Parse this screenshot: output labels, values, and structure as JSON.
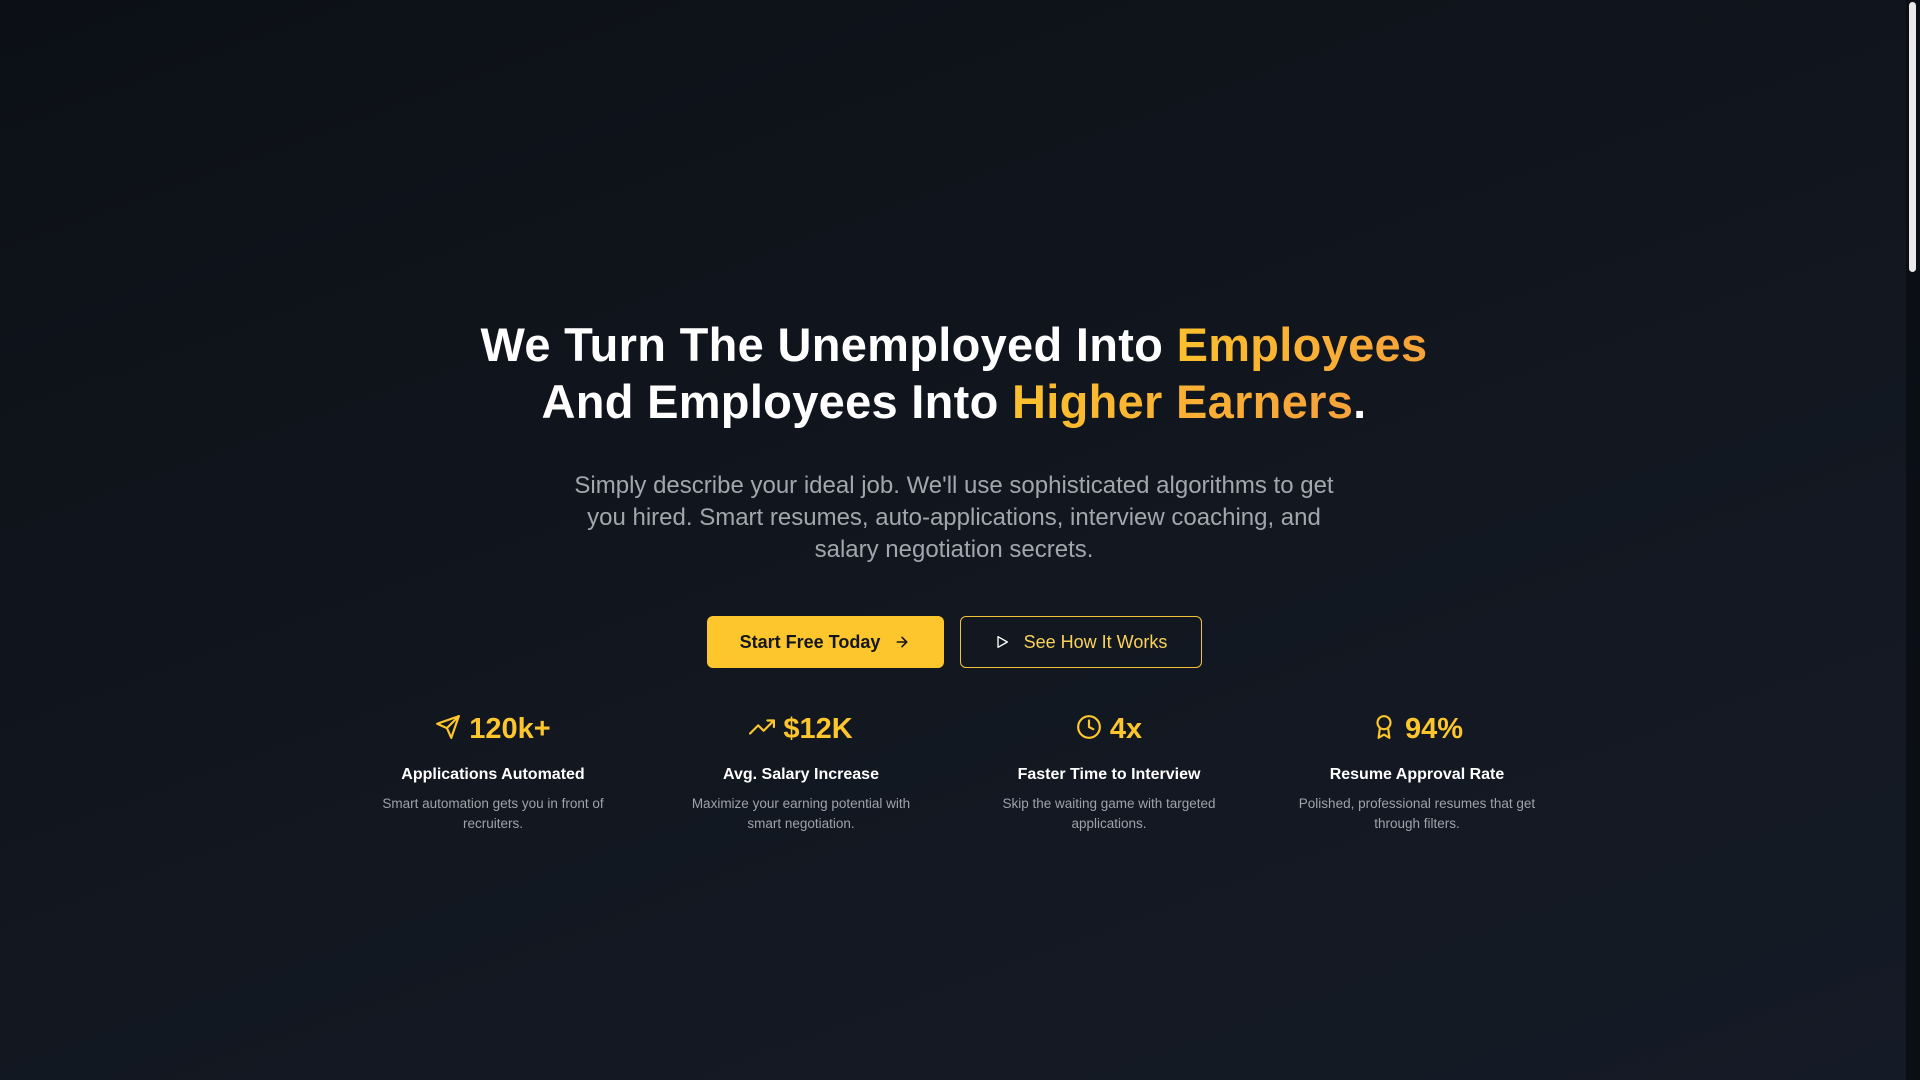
{
  "hero": {
    "headline_line1_prefix": "We Turn The Unemployed Into ",
    "headline_line1_accent": "Employees",
    "headline_line2_prefix": "And Employees Into ",
    "headline_line2_accent": "Higher Earners",
    "headline_line2_suffix": ".",
    "subtitle": "Simply describe your ideal job. We'll use sophisticated algorithms to get you hired. Smart resumes, auto-applications, interview coaching, and salary negotiation secrets.",
    "primary_cta": "Start Free Today",
    "secondary_cta": "See How It Works"
  },
  "stats": [
    {
      "icon": "send-icon",
      "value": "120k+",
      "title": "Applications Automated",
      "description": "Smart automation gets you in front of recruiters."
    },
    {
      "icon": "trending-up-icon",
      "value": "$12K",
      "title": "Avg. Salary Increase",
      "description": "Maximize your earning potential with smart negotiation."
    },
    {
      "icon": "clock-icon",
      "value": "4x",
      "title": "Faster Time to Interview",
      "description": "Skip the waiting game with targeted applications."
    },
    {
      "icon": "award-icon",
      "value": "94%",
      "title": "Resume Approval Rate",
      "description": "Polished, professional resumes that get through filters."
    }
  ],
  "colors": {
    "accent": "#fcc62c",
    "accent_gradient_end": "#f7a23a",
    "background": "#121720",
    "muted_text": "#a2a6ad"
  }
}
